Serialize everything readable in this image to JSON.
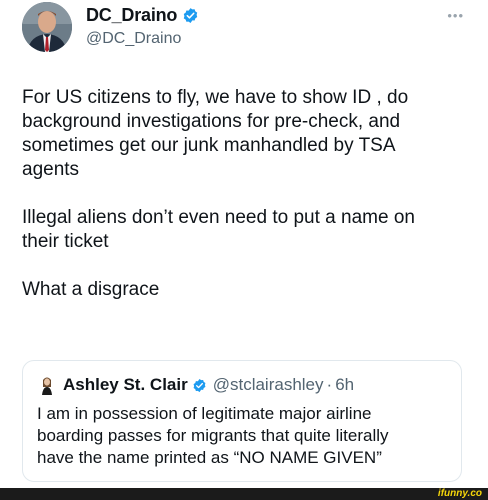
{
  "author": {
    "display_name": "DC_Draino",
    "handle": "@DC_Draino",
    "verified": true,
    "more_icon": "more-dots-icon"
  },
  "tweet": {
    "text": "For US citizens to fly, we have to show ID , do\nbackground investigations for pre-check, and\nsometimes get our junk manhandled by TSA\nagents\n\nIllegal aliens don’t even need to put a name on\ntheir ticket\n\nWhat a disgrace"
  },
  "quoted": {
    "display_name": "Ashley St. Clair",
    "handle": "@stclairashley",
    "separator": "·",
    "time": "6h",
    "verified": true,
    "text": "I am in possession of legitimate major airline\nboarding passes for migrants that quite literally\nhave the name printed as “NO NAME GIVEN”"
  },
  "watermark": {
    "text": "ifunny.co"
  },
  "colors": {
    "verified_blue": "#1d9bf0",
    "secondary_text": "#536471",
    "border": "#e1e8ed",
    "watermark_yellow": "#f5d60a"
  }
}
